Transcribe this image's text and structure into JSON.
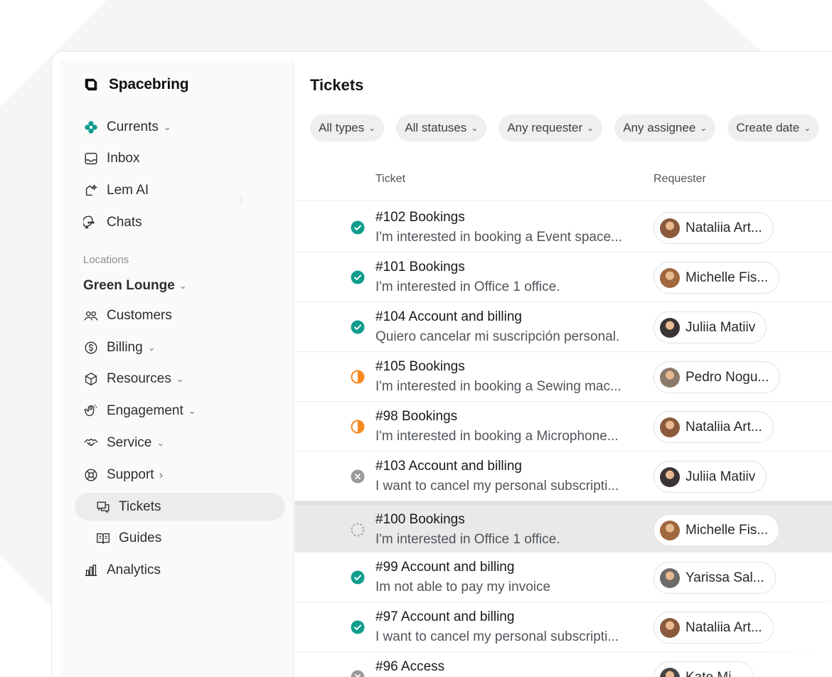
{
  "brand": {
    "name": "Spacebring"
  },
  "sidebar": {
    "top_items": [
      {
        "label": "Currents",
        "icon": "currents-icon",
        "chevron": "⌄"
      },
      {
        "label": "Inbox",
        "icon": "inbox-icon"
      },
      {
        "label": "Lem AI",
        "icon": "lem-ai-icon"
      },
      {
        "label": "Chats",
        "icon": "chat-icon"
      }
    ],
    "section_label": "Locations",
    "location": {
      "name": "Green Lounge",
      "chevron": "⌄"
    },
    "items": [
      {
        "label": "Customers",
        "icon": "customers-icon"
      },
      {
        "label": "Billing",
        "icon": "billing-icon",
        "chevron": "⌄"
      },
      {
        "label": "Resources",
        "icon": "resources-icon",
        "chevron": "⌄"
      },
      {
        "label": "Engagement",
        "icon": "engagement-icon",
        "chevron": "⌄"
      },
      {
        "label": "Service",
        "icon": "service-icon",
        "chevron": "⌄"
      },
      {
        "label": "Support",
        "icon": "support-icon",
        "chevron": "›"
      },
      {
        "label": "Tickets",
        "icon": "tickets-icon",
        "active": true
      },
      {
        "label": "Guides",
        "icon": "guides-icon"
      },
      {
        "label": "Analytics",
        "icon": "analytics-icon"
      }
    ]
  },
  "main": {
    "title": "Tickets",
    "filters": [
      {
        "label": "All types"
      },
      {
        "label": "All statuses"
      },
      {
        "label": "Any requester"
      },
      {
        "label": "Any assignee"
      },
      {
        "label": "Create date"
      }
    ],
    "columns": {
      "ticket": "Ticket",
      "requester": "Requester"
    },
    "tickets": [
      {
        "title": "#102 Bookings",
        "desc": "I'm interested in booking a Event space...",
        "status": "resolved",
        "requester": "Nataliia Art...",
        "avatar": "#8b5a3c"
      },
      {
        "title": "#101 Bookings",
        "desc": "I'm interested in Office 1 office.",
        "status": "resolved",
        "requester": "Michelle Fis...",
        "avatar": "#a0683f"
      },
      {
        "title": "#104 Account and billing",
        "desc": "Quiero cancelar mi suscripción personal.",
        "status": "resolved",
        "requester": "Juliia Matiiv",
        "avatar": "#3b3434"
      },
      {
        "title": "#105 Bookings",
        "desc": "I'm interested in booking a Sewing mac...",
        "status": "in-progress",
        "requester": "Pedro Nogu...",
        "avatar": "#8a7a6a"
      },
      {
        "title": "#98 Bookings",
        "desc": "I'm interested in booking a Microphone...",
        "status": "in-progress",
        "requester": "Nataliia Art...",
        "avatar": "#8b5a3c"
      },
      {
        "title": "#103 Account and billing",
        "desc": "I want to cancel my personal subscripti...",
        "status": "closed",
        "requester": "Juliia Matiiv",
        "avatar": "#3b3434"
      },
      {
        "title": "#100 Bookings",
        "desc": "I'm interested in Office 1 office.",
        "status": "open",
        "requester": "Michelle Fis...",
        "avatar": "#a0683f",
        "selected": true
      },
      {
        "title": "#99 Account and billing",
        "desc": "Im not able to pay my invoice",
        "status": "resolved",
        "requester": "Yarissa Sal...",
        "avatar": "#6d6a68"
      },
      {
        "title": "#97 Account and billing",
        "desc": "I want to cancel my personal subscripti...",
        "status": "resolved",
        "requester": "Nataliia Art...",
        "avatar": "#8b5a3c"
      },
      {
        "title": "#96 Access",
        "desc": "",
        "status": "closed",
        "requester": "Kate Mi...",
        "avatar": "#444444"
      }
    ]
  },
  "colors": {
    "resolved": "#119d8d",
    "in_progress": "#f5891f",
    "closed": "#9a9a9a",
    "open": "#9a9a9a",
    "brand_dark": "#111111"
  }
}
